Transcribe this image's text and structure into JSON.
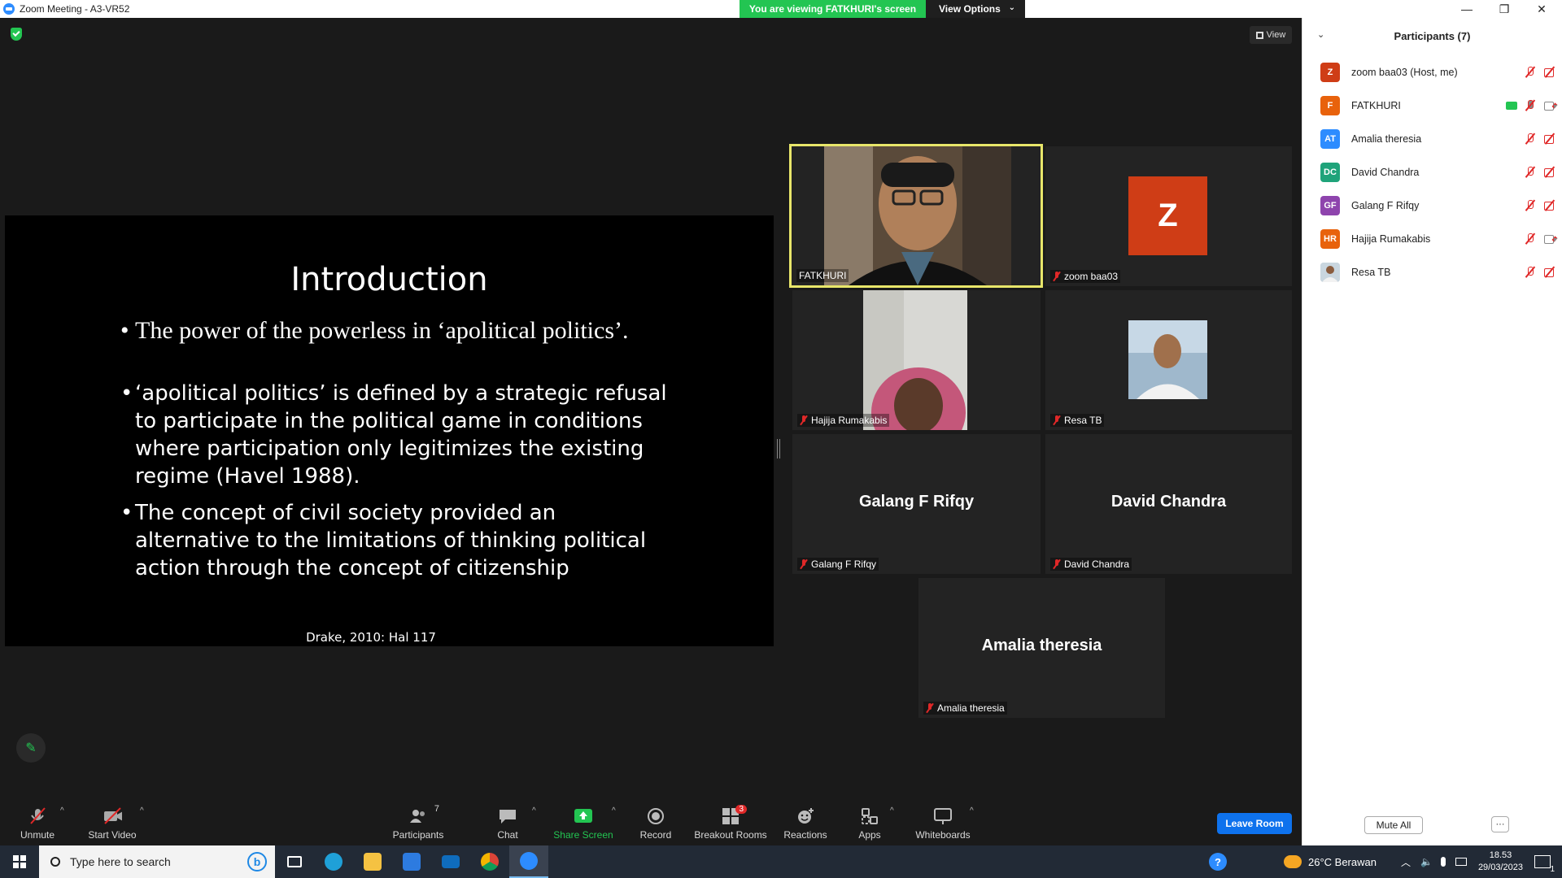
{
  "window": {
    "title": "Zoom Meeting - A3-VR52",
    "viewing_banner": "You are viewing FATKHURI's screen",
    "view_options": "View Options",
    "view_button": "View"
  },
  "slide": {
    "title": "Introduction",
    "bullets": [
      "The power of the powerless in ‘apolitical politics’.",
      "‘apolitical politics’ is defined by a strategic refusal to participate in the political game in conditions where participation only legitimizes the existing regime (Havel 1988).",
      "The concept of civil society provided an alternative to the limitations of thinking political action through the concept of citizenship"
    ],
    "citation": "Drake, 2010: Hal 117"
  },
  "tiles": {
    "fatkhuri": "FATKHURI",
    "zoom_baa03": "zoom baa03",
    "zoom_avatar": "Z",
    "hajija": "Hajija Rumakabis",
    "resa": "Resa TB",
    "galang": "Galang F Rifqy",
    "david": "David Chandra",
    "amalia": "Amalia theresia"
  },
  "toolbar": {
    "unmute": "Unmute",
    "start_video": "Start Video",
    "participants": "Participants",
    "participants_count": "7",
    "chat": "Chat",
    "share_screen": "Share Screen",
    "record": "Record",
    "breakout_rooms": "Breakout Rooms",
    "breakout_badge": "3",
    "reactions": "Reactions",
    "apps": "Apps",
    "whiteboards": "Whiteboards",
    "leave_room": "Leave Room"
  },
  "panel": {
    "title": "Participants (7)",
    "participants": [
      {
        "initials": "Z",
        "name": "zoom baa03 (Host, me)",
        "color": "#cf3d16"
      },
      {
        "initials": "F",
        "name": "FATKHURI",
        "color": "#e8620c"
      },
      {
        "initials": "AT",
        "name": "Amalia theresia",
        "color": "#2d8cff"
      },
      {
        "initials": "DC",
        "name": "David Chandra",
        "color": "#1fa37a"
      },
      {
        "initials": "GF",
        "name": "Galang F Rifqy",
        "color": "#8e44ad"
      },
      {
        "initials": "HR",
        "name": "Hajija Rumakabis",
        "color": "#e8620c"
      },
      {
        "initials": "",
        "name": "Resa TB",
        "color": "#c9d6df"
      }
    ],
    "mute_all": "Mute All",
    "more": "···"
  },
  "taskbar": {
    "search_placeholder": "Type here to search",
    "weather": "26°C  Berawan",
    "time": "18.53",
    "date": "29/03/2023",
    "notification_count": "1"
  },
  "colors": {
    "accent_blue": "#0e72ed",
    "green": "#23c552",
    "muted_red": "#e02828",
    "speaker_border": "#e8e66a"
  }
}
